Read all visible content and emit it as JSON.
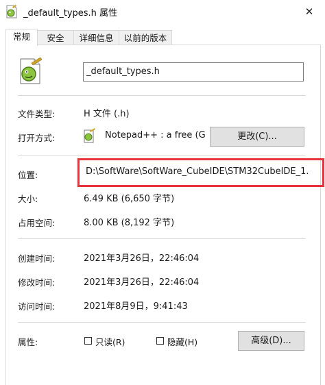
{
  "window": {
    "title": "_default_types.h 属性",
    "close_glyph": "✕"
  },
  "tabs": [
    {
      "label": "常规",
      "active": true
    },
    {
      "label": "安全",
      "active": false
    },
    {
      "label": "详细信息",
      "active": false
    },
    {
      "label": "以前的版本",
      "active": false
    }
  ],
  "general": {
    "file_name": "_default_types.h",
    "file_type_label": "文件类型:",
    "file_type_value": "H 文件 (.h)",
    "open_with_label": "打开方式:",
    "open_with_value": "Notepad++ : a free (GN",
    "change_button": "更改(C)...",
    "location_label": "位置:",
    "location_value": "D:\\SoftWare\\SoftWare_CubeIDE\\STM32CubeIDE_1.",
    "size_label": "大小:",
    "size_value": "6.49 KB (6,650 字节)",
    "disk_size_label": "占用空间:",
    "disk_size_value": "8.00 KB (8,192 字节)",
    "created_label": "创建时间:",
    "created_value": "2021年3月26日，22:46:04",
    "modified_label": "修改时间:",
    "modified_value": "2021年3月26日，22:46:04",
    "accessed_label": "访问时间:",
    "accessed_value": "2021年8月9日，9:41:43",
    "attributes_label": "属性:",
    "readonly_label": "只读(R)",
    "hidden_label": "隐藏(H)",
    "advanced_button": "高级(D)..."
  },
  "colors": {
    "highlight_box": "#e8323c",
    "button_bg": "#e1e1e1"
  },
  "icons": {
    "title": "notepadpp-file-icon",
    "file": "notepadpp-file-icon",
    "open_with": "notepadpp-app-icon"
  }
}
